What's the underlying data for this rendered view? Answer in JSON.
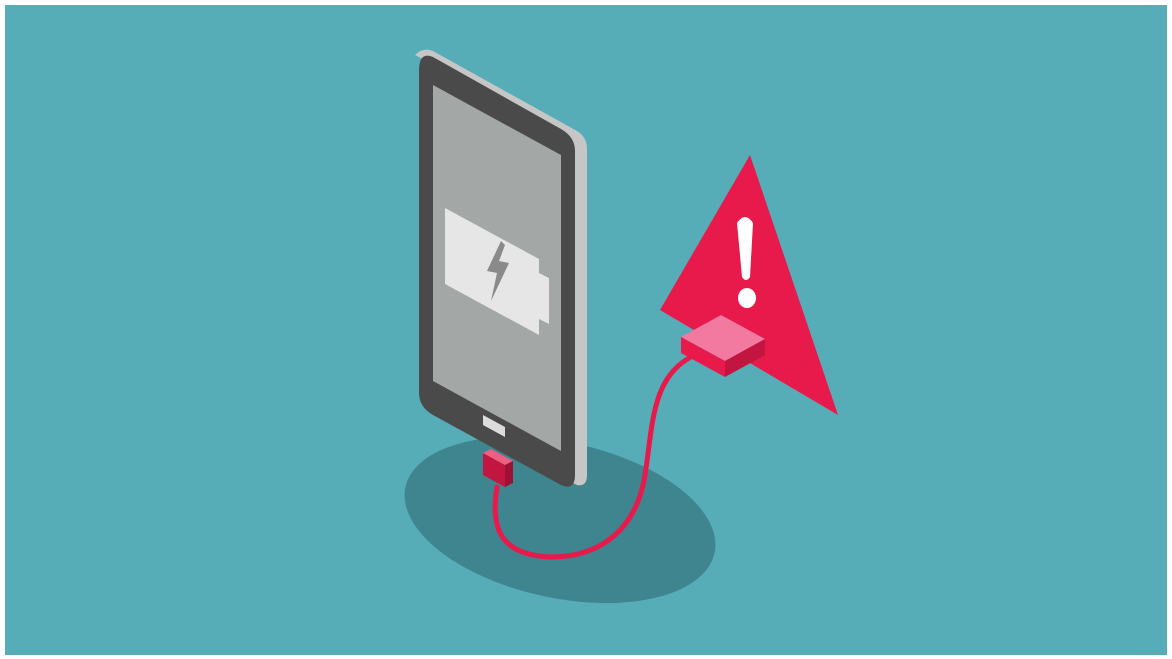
{
  "illustration": {
    "subject": "phone-charging-warning",
    "icons": [
      "smartphone-icon",
      "battery-charging-icon",
      "warning-triangle-icon",
      "exclamation-icon",
      "usb-cable-icon",
      "charger-plug-icon"
    ],
    "colors": {
      "background": "#56adb7",
      "shadow": "#3e8590",
      "phone_body": "#4a4a4a",
      "phone_edge": "#c6c6c6",
      "screen": "#a3a7a6",
      "battery": "#e6e6e6",
      "bolt": "#8a8a8a",
      "warning": "#e8194b",
      "cable": "#e8194b",
      "charger": "#f05f82"
    }
  }
}
